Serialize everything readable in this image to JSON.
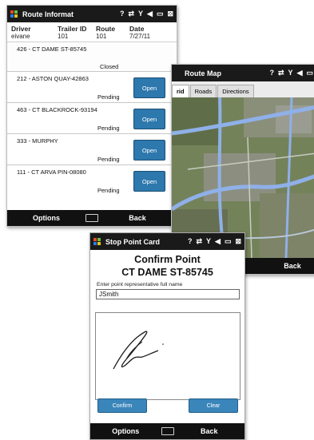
{
  "route_informat": {
    "title": "Route Informat",
    "header_labels": [
      "Driver",
      "Trailer ID",
      "Route",
      "Date"
    ],
    "header_values": [
      "eivane",
      "101",
      "101",
      "7/27/11"
    ],
    "stops": [
      {
        "address": "426 - CT DAME ST-85745",
        "status": "Closed",
        "button": ""
      },
      {
        "address": "212 - ASTON QUAY-42863",
        "status": "Pending",
        "button": "Open"
      },
      {
        "address": "463 - CT BLACKROCK-93194",
        "status": "Pending",
        "button": "Open"
      },
      {
        "address": "333 - MURPHY",
        "status": "Pending",
        "button": "Open"
      },
      {
        "address": "111 - CT ARVA PIN-08080",
        "status": "Pending",
        "button": "Open"
      }
    ],
    "softkeys": {
      "left": "Options",
      "right": "Back"
    }
  },
  "route_map": {
    "title": "Route Map",
    "tabs": [
      "Grid",
      "Roads",
      "Directions"
    ],
    "tab_visible": [
      "rid",
      "Roads",
      "Directions"
    ],
    "active_tab": "Grid",
    "softkeys": {
      "right": "Back"
    }
  },
  "stop_point_card": {
    "title": "Stop Point Card",
    "heading": "Confirm Point",
    "stop_name": "CT DAME ST-85745",
    "prompt": "Enter point representative full name",
    "name_value": "JSmith",
    "confirm_label": "Confirm",
    "clear_label": "Clear",
    "softkeys": {
      "left": "Options",
      "right": "Back"
    }
  },
  "colors": {
    "titlebar": "#1a1a1a",
    "button_blue": "#2d78ad",
    "road_blue": "#8fb0e8"
  }
}
